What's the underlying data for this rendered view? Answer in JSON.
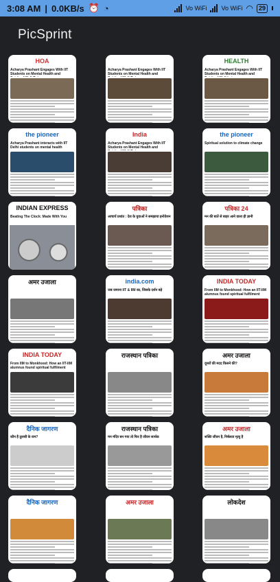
{
  "status": {
    "time": "3:08 AM",
    "speed": "0.0KB/s",
    "net1": "Vo WiFi",
    "net2": "Vo WiFi",
    "battery": "29"
  },
  "app": {
    "title": "PicSprint"
  },
  "colors": {
    "status_bar": "#5f9fe6",
    "background": "#202124"
  },
  "tiles": [
    [
      {
        "mast": "HOA",
        "headline": "Acharya Prashant Engages With IIT Students on Mental Health and Spiritual Well-Being",
        "mast_color": "#d32f2f",
        "photo": "#7b6a55"
      },
      {
        "mast": "",
        "headline": "Acharya Prashant Engages With IIT Students on Mental Health and Spiritual Well-Being",
        "mast_color": "#2e7d32",
        "photo": "#5d4b3a"
      },
      {
        "mast": "HEALTH",
        "headline": "Acharya Prashant Engages With IIT Students on Mental Health and Spiritual Well-being",
        "mast_color": "#2e7d32",
        "photo": "#6b5845"
      }
    ],
    [
      {
        "mast": "the pioneer",
        "headline": "Acharya Prashant interacts with IIT Delhi students on mental health",
        "mast_color": "#1565c0",
        "photo": "#2a4d6b"
      },
      {
        "mast": "India",
        "headline": "Acharya Prashant Engages With IIT Students on Mental Health and Spiritual Well-Being",
        "mast_color": "#c62828",
        "photo": "#4a3d35"
      },
      {
        "mast": "the pioneer",
        "headline": "Spiritual solution to climate change",
        "mast_color": "#1565c0",
        "photo": "#3c5a3e"
      }
    ],
    [
      {
        "mast": "INDIAN EXPRESS",
        "headline": "Beating The Clock: Made With You",
        "mast_color": "#111111",
        "photo": "clock"
      },
      {
        "mast": "पत्रिका",
        "headline": "आचार्य प्रशांत : देश के युवाओं ने समझाया इनोवेशन",
        "mast_color": "#b71c1c",
        "photo": "#6a5a52"
      },
      {
        "mast": "पत्रिका 24",
        "headline": "मन की बातें से बाहर आने वाला ही ज्ञानी",
        "mast_color": "#c62828",
        "photo": "#7a6b5c"
      }
    ],
    [
      {
        "mast": "अमर उजाला",
        "headline": "",
        "mast_color": "#111111",
        "photo": "#777777"
      },
      {
        "mast": "india.com",
        "headline": "जब जमाना IIT & IIM का, जिसके दर्शन बड़े",
        "mast_color": "#1565c0",
        "photo": "#4d3a30"
      },
      {
        "mast": "INDIA TODAY",
        "headline": "From IIM to Monkhood: How an IIT-IIM alumnus found spiritual fulfilment",
        "mast_color": "#c62828",
        "photo": "#8b1a1a"
      }
    ],
    [
      {
        "mast": "INDIA TODAY",
        "headline": "From IIM to Monkhood: How an IIT-IIM alumnus found spiritual fulfilment",
        "mast_color": "#c62828",
        "photo": "#3b3b3b"
      },
      {
        "mast": "राजस्थान पत्रिका",
        "headline": "",
        "mast_color": "#111111",
        "photo": "#888888"
      },
      {
        "mast": "अमर उजाला",
        "headline": "दूसरों की मदद किसने की?",
        "mast_color": "#111111",
        "photo": "#c77a3a"
      }
    ],
    [
      {
        "mast": "दैनिक जागरण",
        "headline": "कौन है तुलसी के राम?",
        "mast_color": "#1565c0",
        "photo": "#cccccc"
      },
      {
        "mast": "राजस्थान पत्रिका",
        "headline": "मन मंदिर बन गया तो फिर है जीवन सार्थक",
        "mast_color": "#111111",
        "photo": "#999999"
      },
      {
        "mast": "अमर उजाला",
        "headline": "शक्ति जीवन है, निर्बलता मृत्यु है",
        "mast_color": "#c62828",
        "photo": "#d98a3a"
      }
    ],
    [
      {
        "mast": "दैनिक जागरण",
        "headline": "",
        "mast_color": "#1565c0",
        "photo": "#d08a3a"
      },
      {
        "mast": "अमर उजाला",
        "headline": "",
        "mast_color": "#c62828",
        "photo": "#6b7a55"
      },
      {
        "mast": "लोकदेश",
        "headline": "",
        "mast_color": "#111111",
        "photo": "#888888"
      }
    ]
  ]
}
